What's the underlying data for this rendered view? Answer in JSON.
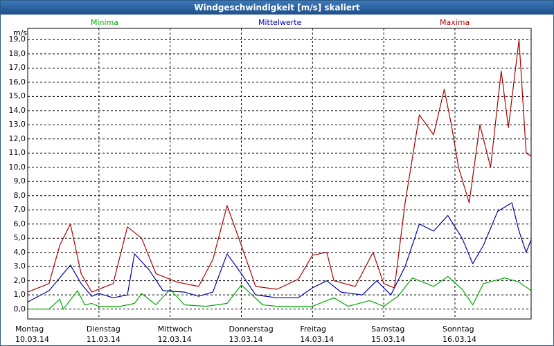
{
  "window": {
    "title": "Windgeschwindigkeit [m/s] skaliert"
  },
  "colors": {
    "minima": "#00aa00",
    "mittel": "#0000aa",
    "maxima": "#aa0000",
    "grid": "#000000"
  },
  "chart_data": {
    "type": "line",
    "title": "Windgeschwindigkeit [m/s] skaliert",
    "ylabel": "m/s",
    "ylim": [
      -0.7,
      19.8
    ],
    "yticks": [
      "0,0",
      "1,0",
      "2,0",
      "3,0",
      "4,0",
      "5,0",
      "6,0",
      "7,0",
      "8,0",
      "9,0",
      "10,0",
      "11,0",
      "12,0",
      "13,0",
      "14,0",
      "15,0",
      "16,0",
      "17,0",
      "18,0",
      "19,0"
    ],
    "xlim": [
      0,
      7.07
    ],
    "categories": [
      {
        "day": "Montag",
        "date": "10.03.14"
      },
      {
        "day": "Dienstag",
        "date": "11.03.14"
      },
      {
        "day": "Mittwoch",
        "date": "12.03.14"
      },
      {
        "day": "Donnerstag",
        "date": "13.03.14"
      },
      {
        "day": "Freitag",
        "date": "14.03.14"
      },
      {
        "day": "Samstag",
        "date": "15.03.14"
      },
      {
        "day": "Sonntag",
        "date": "16.03.14"
      }
    ],
    "grid": true,
    "series": [
      {
        "name": "Minima",
        "color": "#00aa00",
        "points": [
          [
            0,
            0
          ],
          [
            0.3,
            0
          ],
          [
            0.45,
            0.7
          ],
          [
            0.5,
            0
          ],
          [
            0.7,
            1.3
          ],
          [
            0.8,
            0.3
          ],
          [
            0.9,
            0.4
          ],
          [
            1.0,
            0.2
          ],
          [
            1.3,
            0.2
          ],
          [
            1.5,
            0.4
          ],
          [
            1.6,
            1.1
          ],
          [
            1.8,
            0.3
          ],
          [
            2.0,
            1.4
          ],
          [
            2.2,
            0.3
          ],
          [
            2.5,
            0.2
          ],
          [
            2.8,
            0.4
          ],
          [
            3.0,
            1.7
          ],
          [
            3.3,
            0.3
          ],
          [
            3.5,
            0.2
          ],
          [
            4.0,
            0.2
          ],
          [
            4.3,
            0.8
          ],
          [
            4.5,
            0.2
          ],
          [
            4.8,
            0.6
          ],
          [
            5.0,
            0.2
          ],
          [
            5.2,
            0.9
          ],
          [
            5.4,
            2.2
          ],
          [
            5.7,
            1.6
          ],
          [
            5.9,
            2.3
          ],
          [
            6.1,
            1.4
          ],
          [
            6.25,
            0.3
          ],
          [
            6.4,
            1.8
          ],
          [
            6.7,
            2.2
          ],
          [
            6.9,
            1.9
          ],
          [
            7.07,
            1.3
          ]
        ]
      },
      {
        "name": "Mittelwerte",
        "color": "#0000aa",
        "points": [
          [
            0,
            0.5
          ],
          [
            0.3,
            1.3
          ],
          [
            0.5,
            2.5
          ],
          [
            0.6,
            3.1
          ],
          [
            0.75,
            1.8
          ],
          [
            0.9,
            0.9
          ],
          [
            1.0,
            1.1
          ],
          [
            1.2,
            0.8
          ],
          [
            1.4,
            1.0
          ],
          [
            1.5,
            3.9
          ],
          [
            1.7,
            2.8
          ],
          [
            1.9,
            1.3
          ],
          [
            2.2,
            1.2
          ],
          [
            2.4,
            0.9
          ],
          [
            2.6,
            1.2
          ],
          [
            2.8,
            3.9
          ],
          [
            3.0,
            2.5
          ],
          [
            3.2,
            1.0
          ],
          [
            3.5,
            0.8
          ],
          [
            3.8,
            0.8
          ],
          [
            4.0,
            1.5
          ],
          [
            4.2,
            2.0
          ],
          [
            4.4,
            1.2
          ],
          [
            4.7,
            1.0
          ],
          [
            4.9,
            2.0
          ],
          [
            5.1,
            1.0
          ],
          [
            5.3,
            3.0
          ],
          [
            5.5,
            6.0
          ],
          [
            5.7,
            5.5
          ],
          [
            5.9,
            6.6
          ],
          [
            6.1,
            5.0
          ],
          [
            6.25,
            3.2
          ],
          [
            6.4,
            4.5
          ],
          [
            6.6,
            6.9
          ],
          [
            6.8,
            7.5
          ],
          [
            6.9,
            5.5
          ],
          [
            7.0,
            4.0
          ],
          [
            7.07,
            4.9
          ]
        ]
      },
      {
        "name": "Maxima",
        "color": "#aa0000",
        "points": [
          [
            0,
            1.2
          ],
          [
            0.3,
            1.8
          ],
          [
            0.45,
            4.5
          ],
          [
            0.6,
            6.0
          ],
          [
            0.75,
            2.5
          ],
          [
            0.9,
            1.2
          ],
          [
            1.2,
            1.8
          ],
          [
            1.4,
            5.8
          ],
          [
            1.6,
            5.0
          ],
          [
            1.8,
            2.5
          ],
          [
            2.1,
            1.9
          ],
          [
            2.4,
            1.6
          ],
          [
            2.6,
            3.5
          ],
          [
            2.8,
            7.3
          ],
          [
            3.0,
            4.5
          ],
          [
            3.2,
            1.6
          ],
          [
            3.5,
            1.4
          ],
          [
            3.8,
            2.1
          ],
          [
            4.0,
            3.8
          ],
          [
            4.2,
            4.0
          ],
          [
            4.3,
            2.0
          ],
          [
            4.6,
            1.6
          ],
          [
            4.85,
            4.0
          ],
          [
            5.0,
            1.8
          ],
          [
            5.15,
            1.5
          ],
          [
            5.3,
            7.5
          ],
          [
            5.5,
            13.7
          ],
          [
            5.7,
            12.3
          ],
          [
            5.85,
            15.5
          ],
          [
            5.95,
            13.0
          ],
          [
            6.05,
            10.0
          ],
          [
            6.2,
            7.5
          ],
          [
            6.35,
            13.0
          ],
          [
            6.5,
            10.0
          ],
          [
            6.65,
            16.8
          ],
          [
            6.75,
            12.8
          ],
          [
            6.9,
            19.0
          ],
          [
            7.0,
            11.0
          ],
          [
            7.07,
            10.8
          ]
        ]
      }
    ]
  }
}
